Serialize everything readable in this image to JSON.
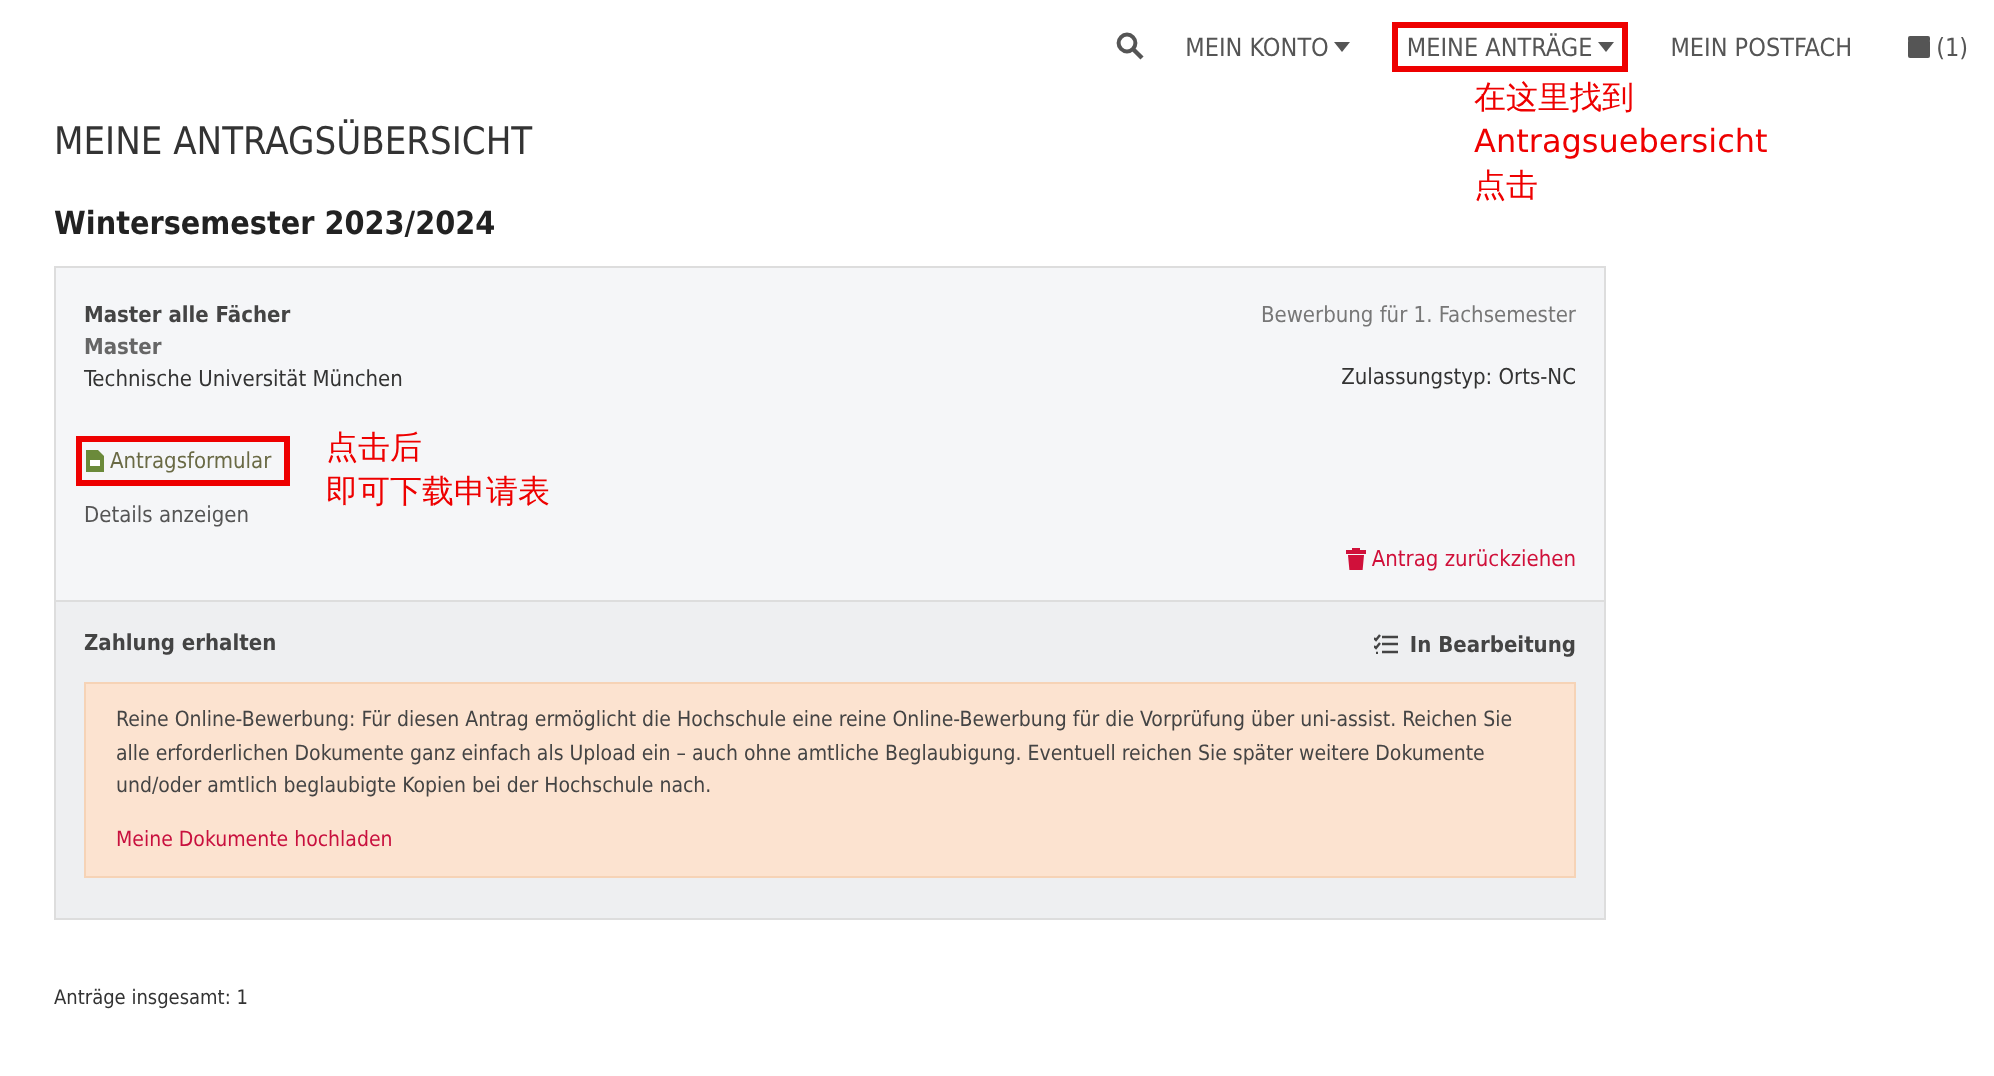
{
  "nav": {
    "items": [
      {
        "label": "MEIN KONTO",
        "dropdown": true,
        "highlighted": false
      },
      {
        "label": "MEINE ANTRÄGE",
        "dropdown": true,
        "highlighted": true
      },
      {
        "label": "MEIN POSTFACH",
        "dropdown": false,
        "highlighted": false
      }
    ],
    "cart_count": "(1)"
  },
  "page_title": "MEINE ANTRAGSÜBERSICHT",
  "semester": "Wintersemester 2023/2024",
  "application": {
    "program": "Master alle Fächer",
    "degree": "Master",
    "university": "Technische Universität München",
    "application_type": "Bewerbung für 1. Fachsemester",
    "admission": "Zulassungstyp: Orts-NC",
    "form_link": {
      "label": "Antragsformular",
      "highlighted": true
    },
    "details_link": "Details anzeigen",
    "withdraw": "Antrag zurückziehen",
    "payment_status": "Zahlung erhalten",
    "processing_status": "In Bearbeitung",
    "notice": "Reine Online-Bewerbung: Für diesen Antrag ermöglicht die Hochschule eine reine Online-Bewerbung für die Vorprüfung über uni-assist. Reichen Sie alle erforderlichen Dokumente ganz einfach als Upload ein – auch ohne amtliche Beglaubigung. Eventuell reichen Sie später weitere Dokumente und/oder amtlich beglaubigte Kopien bei der Hochschule nach.",
    "upload_link": "Meine Dokumente hochladen"
  },
  "total": "Anträge insgesamt: 1",
  "annotations": [
    {
      "lines": [
        "在这里找到",
        "Antragsuebersicht",
        "点击"
      ]
    },
    {
      "lines": [
        "点击后",
        "即可下载申请表"
      ]
    }
  ]
}
